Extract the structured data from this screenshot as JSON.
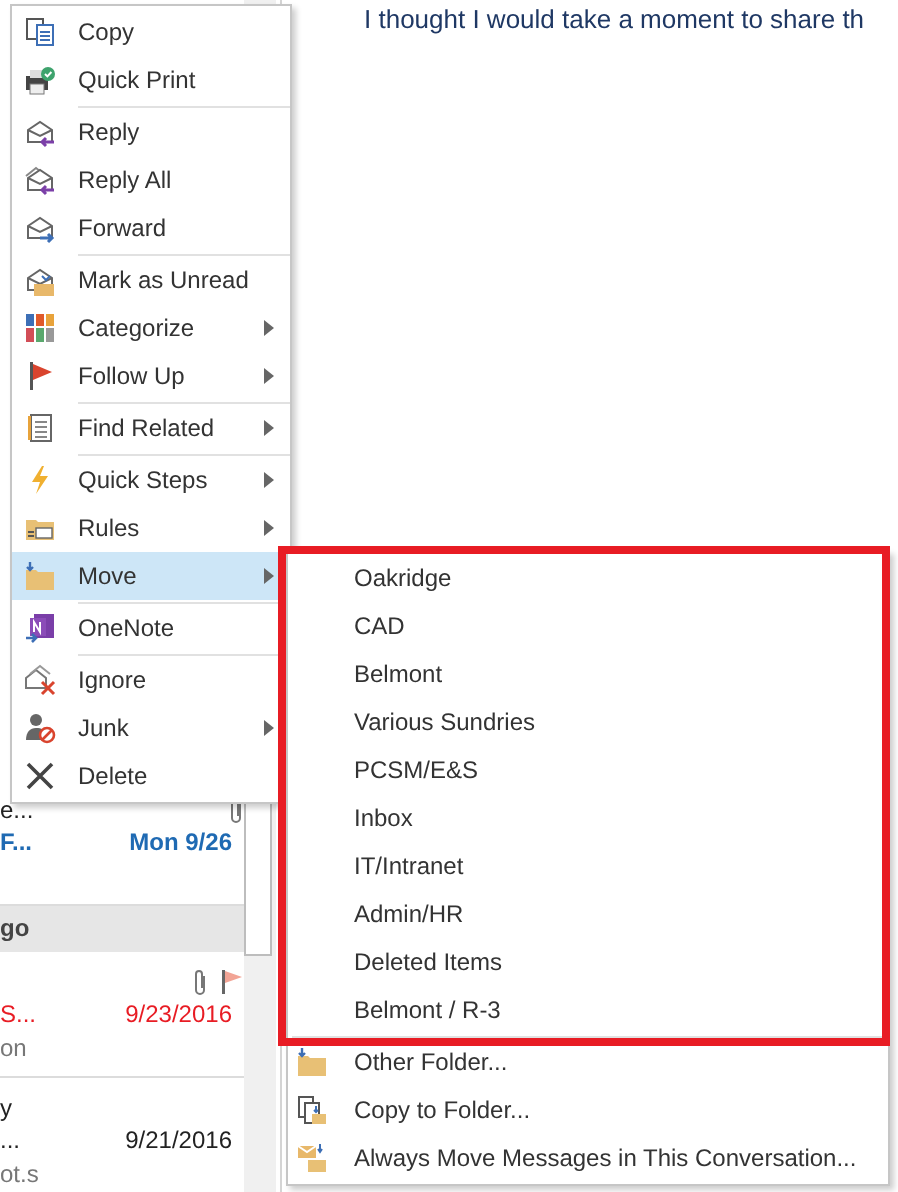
{
  "reading_pane": {
    "first_line": "I thought I would take a moment to share th"
  },
  "message_list": {
    "rows": [
      {
        "kind": "message",
        "line_1": "e...",
        "line_2": "F...",
        "line_3": "",
        "date": "Mon 9/26",
        "unread": true,
        "overdue": false,
        "attachment": true,
        "flagged": false
      },
      {
        "kind": "group",
        "line_1": "go"
      },
      {
        "kind": "message",
        "line_1": "",
        "line_2": "S...",
        "line_3": "on",
        "date": "9/23/2016",
        "unread": false,
        "overdue": true,
        "attachment": true,
        "flagged": true
      },
      {
        "kind": "message",
        "line_1": "y",
        "line_2": "...",
        "line_3": "ot.s",
        "date": "9/21/2016",
        "unread": false,
        "overdue": false,
        "attachment": false,
        "flagged": false
      }
    ]
  },
  "context_menu": {
    "items": [
      {
        "kind": "item",
        "label": "Copy",
        "submenu": false,
        "selected": false
      },
      {
        "kind": "item",
        "label": "Quick Print",
        "submenu": false,
        "selected": false
      },
      {
        "kind": "separator"
      },
      {
        "kind": "item",
        "label": "Reply",
        "submenu": false,
        "selected": false
      },
      {
        "kind": "item",
        "label": "Reply All",
        "submenu": false,
        "selected": false
      },
      {
        "kind": "item",
        "label": "Forward",
        "submenu": false,
        "selected": false
      },
      {
        "kind": "separator"
      },
      {
        "kind": "item",
        "label": "Mark as Unread",
        "submenu": false,
        "selected": false
      },
      {
        "kind": "item",
        "label": "Categorize",
        "submenu": true,
        "selected": false
      },
      {
        "kind": "item",
        "label": "Follow Up",
        "submenu": true,
        "selected": false
      },
      {
        "kind": "separator"
      },
      {
        "kind": "item",
        "label": "Find Related",
        "submenu": true,
        "selected": false
      },
      {
        "kind": "separator"
      },
      {
        "kind": "item",
        "label": "Quick Steps",
        "submenu": true,
        "selected": false
      },
      {
        "kind": "item",
        "label": "Rules",
        "submenu": true,
        "selected": false
      },
      {
        "kind": "item",
        "label": "Move",
        "submenu": true,
        "selected": true
      },
      {
        "kind": "separator"
      },
      {
        "kind": "item",
        "label": "OneNote",
        "submenu": false,
        "selected": false
      },
      {
        "kind": "separator"
      },
      {
        "kind": "item",
        "label": "Ignore",
        "submenu": false,
        "selected": false
      },
      {
        "kind": "item",
        "label": "Junk",
        "submenu": true,
        "selected": false
      },
      {
        "kind": "item",
        "label": "Delete",
        "submenu": false,
        "selected": false
      }
    ]
  },
  "move_submenu": {
    "folders_highlighted": true,
    "items": [
      {
        "kind": "folder",
        "label": "Oakridge"
      },
      {
        "kind": "folder",
        "label": "CAD"
      },
      {
        "kind": "folder",
        "label": "Belmont"
      },
      {
        "kind": "folder",
        "label": "Various Sundries"
      },
      {
        "kind": "folder",
        "label": "PCSM/E&S"
      },
      {
        "kind": "folder",
        "label": "Inbox"
      },
      {
        "kind": "folder",
        "label": "IT/Intranet"
      },
      {
        "kind": "folder",
        "label": "Admin/HR"
      },
      {
        "kind": "folder",
        "label": "Deleted Items"
      },
      {
        "kind": "folder",
        "label": "Belmont / R-3"
      },
      {
        "kind": "separator"
      },
      {
        "kind": "command",
        "label": "Other Folder..."
      },
      {
        "kind": "command",
        "label": "Copy to Folder..."
      },
      {
        "kind": "command",
        "label": "Always Move Messages in This Conversation..."
      }
    ]
  }
}
